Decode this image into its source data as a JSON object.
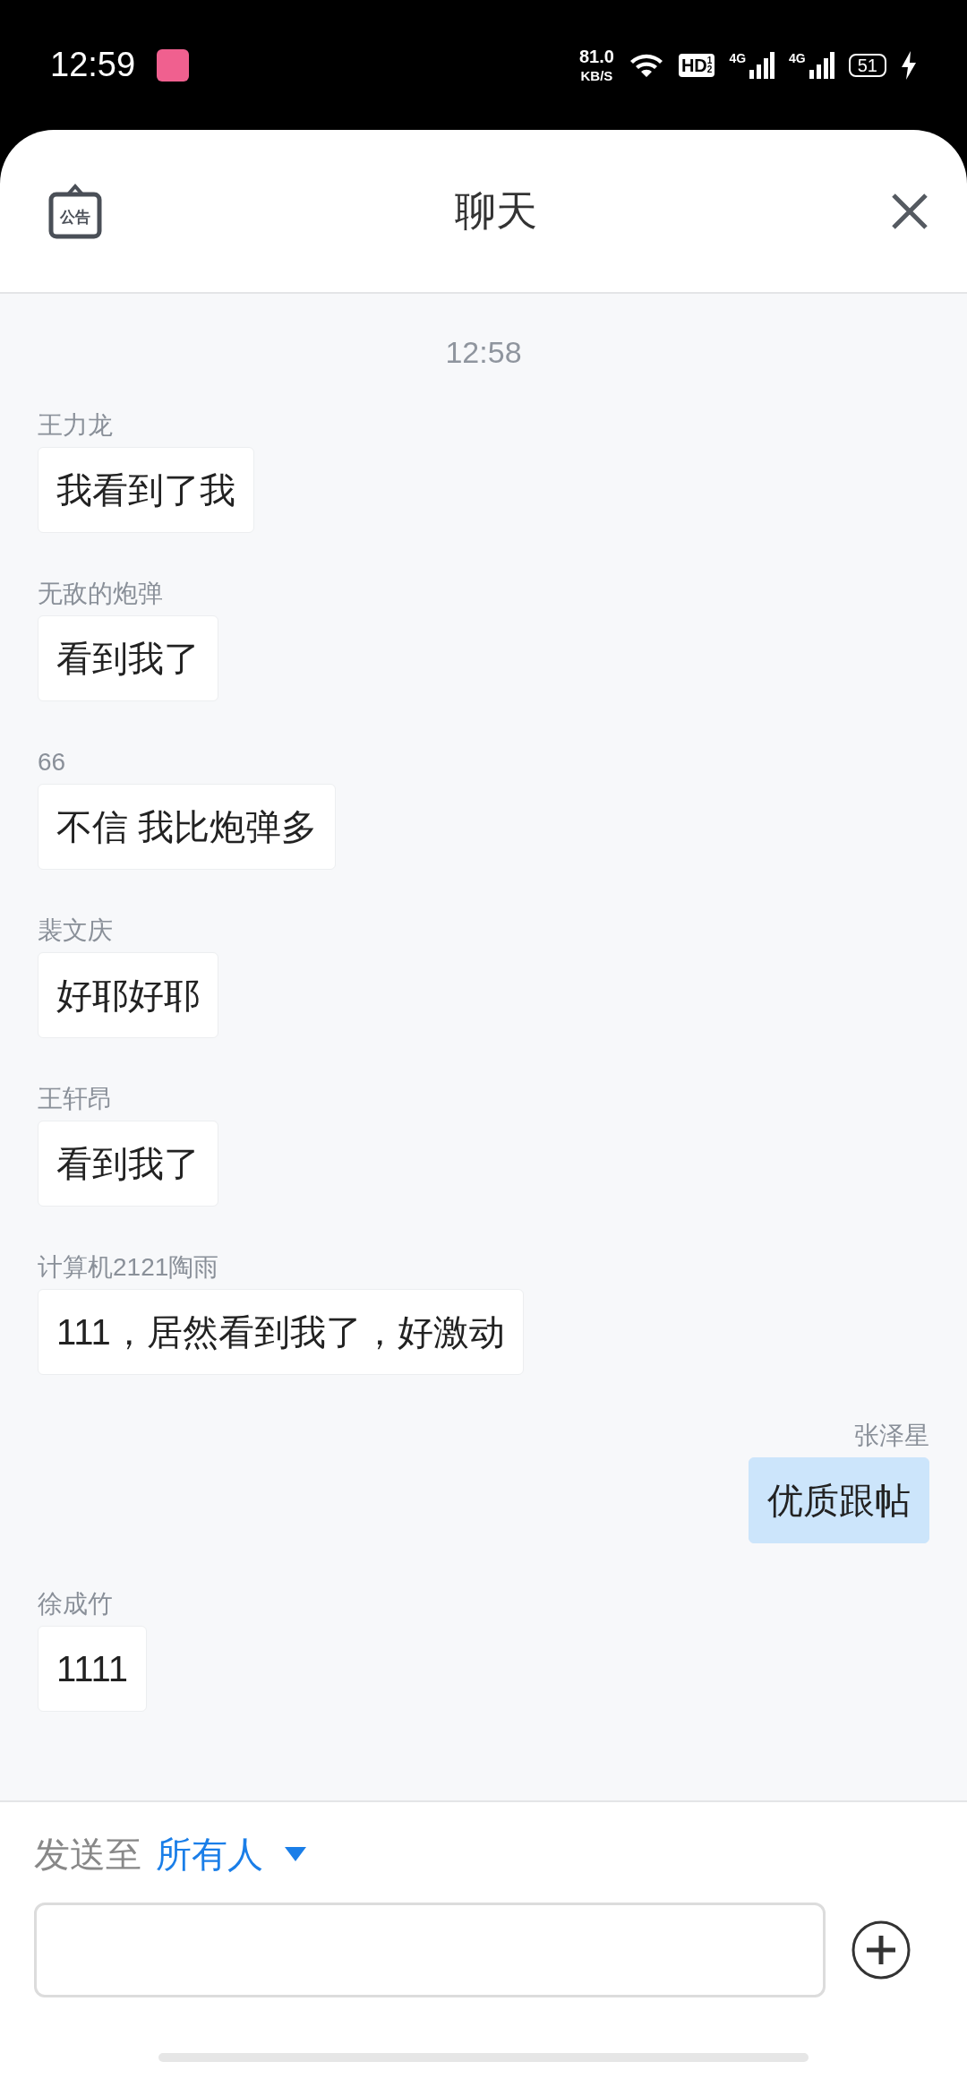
{
  "status_bar": {
    "time": "12:59",
    "speed": "81.0",
    "speed_unit": "KB/S",
    "hd": "HD",
    "hd_sub": "1",
    "hd_sub2": "2",
    "network_1": "4G",
    "network_2": "4G",
    "battery": "51"
  },
  "header": {
    "notice_label": "公告",
    "title": "聊天"
  },
  "chat": {
    "timestamp": "12:58",
    "messages": [
      {
        "kind": "other",
        "sender": "王力龙",
        "text": "我看到了我"
      },
      {
        "kind": "other",
        "sender": "无敌的炮弹",
        "text": "看到我了"
      },
      {
        "kind": "other",
        "sender": "66",
        "text": "不信 我比炮弹多"
      },
      {
        "kind": "other",
        "sender": "裴文庆",
        "text": "好耶好耶"
      },
      {
        "kind": "other",
        "sender": "王轩昂",
        "text": "看到我了"
      },
      {
        "kind": "other",
        "sender": "计算机2121陶雨",
        "text": "111，居然看到我了，好激动"
      },
      {
        "kind": "self",
        "sender": "张泽星",
        "text": "优质跟帖"
      },
      {
        "kind": "other",
        "sender": "徐成竹",
        "text": "1111"
      }
    ]
  },
  "composer": {
    "send_to_label": "发送至",
    "recipient": "所有人"
  }
}
